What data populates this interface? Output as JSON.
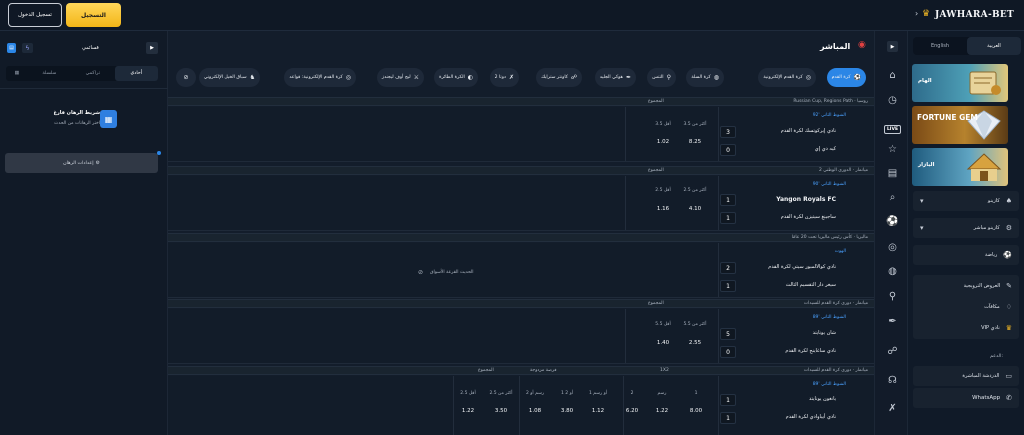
{
  "header": {
    "register_label": "التسجيل",
    "login_label": "تسجيل الدخول",
    "logo": "JAWHARA-BET"
  },
  "sidebar": {
    "languages": [
      {
        "label": "العربية",
        "active": true
      },
      {
        "label": "English",
        "active": false
      }
    ],
    "promos": [
      {
        "label": "الهام"
      },
      {
        "label": "FORTUNE GEM"
      },
      {
        "label": "البازار"
      }
    ],
    "items": [
      {
        "label": "كازينو",
        "icon": "chevron-down-icon"
      },
      {
        "label": "كازينو مباشر",
        "icon": "chevron-down-icon"
      },
      {
        "label": "رياضة",
        "icon": "sports-icon"
      },
      {
        "label": "العروض الترويجية",
        "icon": "gift-icon"
      },
      {
        "label": "مكافآت",
        "icon": "bonus-icon"
      },
      {
        "label": "VIP نادي",
        "icon": "crown-icon"
      }
    ],
    "support_title": "الدعم:",
    "support": [
      {
        "label": "الدردشة المباشرة"
      },
      {
        "label": "WhatsApp"
      }
    ]
  },
  "main": {
    "title": "المباشر",
    "chips": [
      {
        "label": "كرة القدم",
        "active": true
      },
      {
        "label": "كرة القدم الإلكترونية"
      },
      {
        "label": "كرة السلة"
      },
      {
        "label": "التنس"
      },
      {
        "label": "هوكي الجليد"
      },
      {
        "label": "كاونتر سترايك"
      },
      {
        "label": "دوتا 2"
      },
      {
        "label": "الكرة الطائرة"
      },
      {
        "label": "ليج أوف ليجندز"
      },
      {
        "label": "كرة القدم الإلكترونية: قواعد"
      },
      {
        "label": "سباق الخيل الإلكتروني"
      }
    ],
    "events": [
      {
        "league": "Russian Cup, Regions Path · روسيا",
        "market": "المجموع",
        "time": "92' الشوط الثاني",
        "teams": [
          "نادي إيركوتسك لكرة القدم",
          "كيه دي إي"
        ],
        "scores": [
          "3",
          "0"
        ],
        "odd_headers": [
          "أكثر من 3.5",
          "أقل 3.5"
        ],
        "odds": [
          "8.25",
          "1.02"
        ]
      },
      {
        "league": "ميانمار · الدوري الوطني 2",
        "market": "المجموع",
        "time": "90' الشوط الثاني",
        "teams": [
          "Yangon Royals FC",
          "ساجينغ سيتيزن لكرة القدم"
        ],
        "scores": [
          "1",
          "1"
        ],
        "odd_headers": [
          "أكثر من 2.5",
          "أقل 2.5"
        ],
        "odds": [
          "4.10",
          "1.16"
        ]
      },
      {
        "league": "ماليزيا · كأس رئيس ماليزيا تحت 20 عامًا",
        "market": "",
        "time": "الهوت",
        "teams": [
          "نادي كوالالمبور سيتي لكرة القدم",
          "سيغر دار التقسيم الثالث"
        ],
        "scores": [
          "2",
          "1"
        ],
        "locked": "الحديث القرعة الأسواق"
      },
      {
        "league": "ميانمار · دوري كرة القدم للسيدات",
        "market": "المجموع",
        "time": "89' الشوط الثاني",
        "teams": [
          "شان يونايتد",
          "نادي ساغاينج لكرة القدم"
        ],
        "scores": [
          "5",
          "0"
        ],
        "odd_headers": [
          "أكثر من 5.5",
          "أقل 5.5"
        ],
        "odds": [
          "2.55",
          "1.40"
        ]
      },
      {
        "league": "ميانمار · دوري كرة القدم للسيدات",
        "market": "1X2",
        "market2": "فرصة مزدوجة",
        "market3": "المجموع",
        "time": "89' الشوط الثاني",
        "teams": [
          "يانغون يونايتد",
          "نادي أيياوادي لكرة القدم"
        ],
        "scores": [
          "1",
          "1"
        ],
        "odd_headers": [
          "1",
          "رسم",
          "2",
          "1 أو رسم",
          "1 أو 2",
          "رسم أو 2",
          "أكثر من 2.5",
          "أقل 2.5"
        ],
        "odds": [
          "8.00",
          "1.22",
          "6.20",
          "1.12",
          "3.80",
          "1.08",
          "3.50",
          "1.22"
        ]
      }
    ]
  },
  "betslip": {
    "title": "قسائمي",
    "tabs": [
      {
        "label": "أحادي",
        "active": true
      },
      {
        "label": "تراكمي"
      },
      {
        "label": "سلسلة"
      }
    ],
    "empty_title": "شريط الرهان فارغ",
    "empty_sub": "اختر الرهانات من الحدث",
    "settings_label": "إعدادات الرهان"
  }
}
